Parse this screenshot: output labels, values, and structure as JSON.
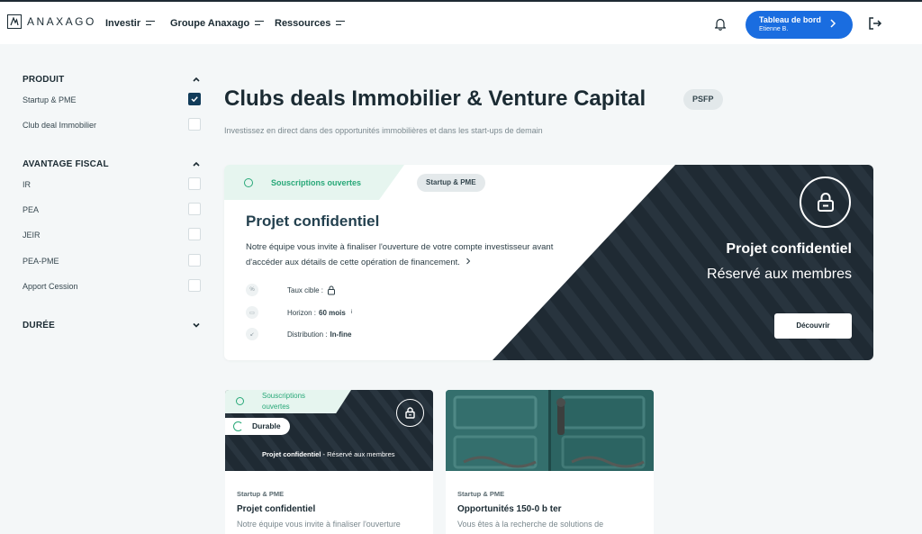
{
  "header": {
    "logo_text": "ANAXAGO",
    "nav": [
      {
        "label": "Investir"
      },
      {
        "label": "Groupe Anaxago"
      },
      {
        "label": "Ressources"
      }
    ],
    "dashboard_button": {
      "title": "Tableau de bord",
      "user": "Etienne B."
    }
  },
  "sidebar": {
    "produit": {
      "heading": "PRODUIT",
      "items": [
        {
          "label": "Startup & PME",
          "checked": true
        },
        {
          "label": "Club deal Immobilier",
          "checked": false
        }
      ]
    },
    "avantage": {
      "heading": "AVANTAGE FISCAL",
      "items": [
        {
          "label": "IR",
          "checked": false
        },
        {
          "label": "PEA",
          "checked": false
        },
        {
          "label": "JEIR",
          "checked": false
        },
        {
          "label": "PEA-PME",
          "checked": false
        },
        {
          "label": "Apport Cession",
          "checked": false
        }
      ]
    },
    "duree": {
      "heading": "DURÉE"
    }
  },
  "main": {
    "title": "Clubs deals Immobilier & Venture Capital",
    "badge": "PSFP",
    "subtitle": "Investissez en direct dans des opportunités immobilières et dans les start-ups de demain"
  },
  "featured": {
    "status": "Souscriptions ouvertes",
    "tag": "Startup & PME",
    "title": "Projet confidentiel",
    "description": "Notre équipe vous invite à finaliser l'ouverture de votre compte investisseur avant d'accéder aux détails de cette opération de financement.",
    "rows": [
      {
        "icon": "%",
        "label": "Taux cible :",
        "value": ""
      },
      {
        "icon": "▭",
        "label": "Horizon :",
        "value": "60 mois",
        "info": "i"
      },
      {
        "icon": "↙",
        "label": "Distribution :",
        "value": "In-fine"
      }
    ],
    "dark_title": "Projet confidentiel",
    "dark_subtitle": "Réservé aux membres",
    "button": "Découvrir"
  },
  "cards": [
    {
      "status_line1": "Souscriptions",
      "status_line2": "ouvertes",
      "badge": "Durable",
      "caption_bold": "Projet confidentiel",
      "caption_rest": " - Réservé aux membres",
      "category": "Startup & PME",
      "title": "Projet confidentiel",
      "description": "Notre équipe vous invite à finaliser l'ouverture"
    },
    {
      "category": "Startup & PME",
      "title": "Opportunités 150-0 b ter",
      "description": "Vous êtes à la recherche de solutions de"
    }
  ],
  "colors": {
    "accent": "#1a6de0",
    "dark": "#1f2a33",
    "green": "#28a878"
  }
}
